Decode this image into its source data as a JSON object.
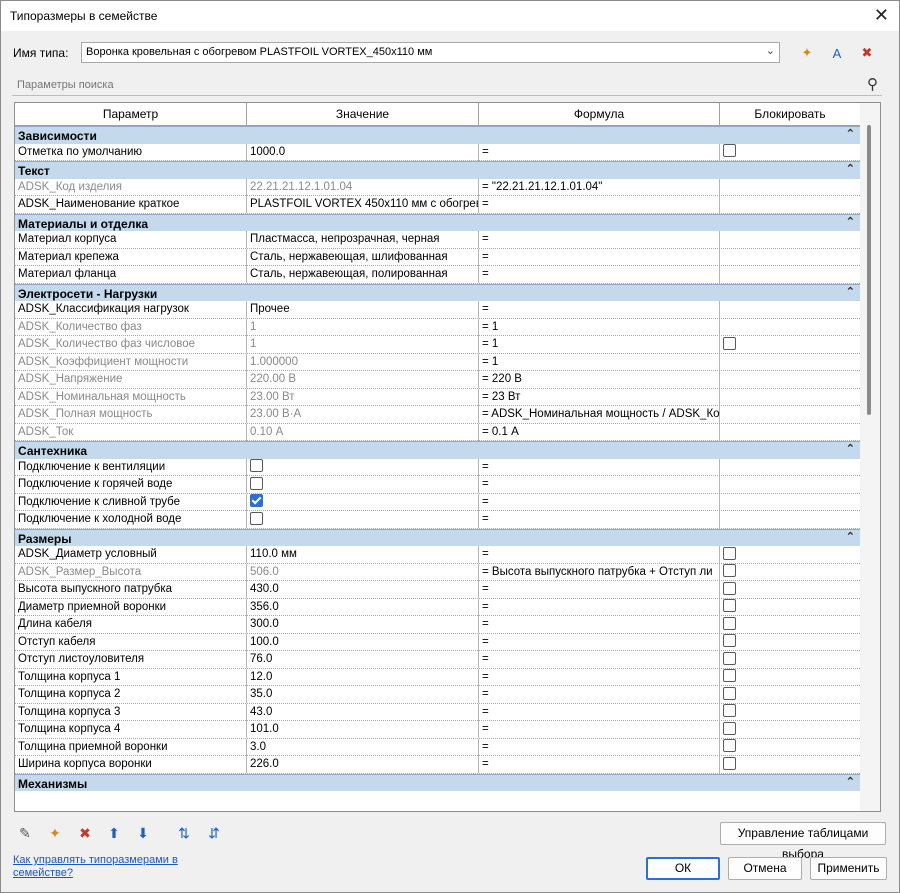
{
  "window": {
    "title": "Типоразмеры в семействе",
    "close_label": "✕"
  },
  "type_row": {
    "label": "Имя типа:",
    "value": "Воронка кровельная с обогревом PLASTFOIL VORTEX_450x110 мм"
  },
  "search": {
    "placeholder": "Параметры поиска"
  },
  "columns": [
    "Параметр",
    "Значение",
    "Формула",
    "Блокировать"
  ],
  "groups": [
    {
      "name": "Зависимости",
      "rows": [
        {
          "param": "Отметка по умолчанию",
          "value": "1000.0",
          "formula": "=",
          "lock": "unchecked",
          "readonly": false
        }
      ]
    },
    {
      "name": "Текст",
      "rows": [
        {
          "param": "ADSK_Код изделия",
          "value": "22.21.21.12.1.01.04",
          "formula": "= \"22.21.21.12.1.01.04\"",
          "lock": "none",
          "readonly": true
        },
        {
          "param": "ADSK_Наименование краткое",
          "value": "PLASTFOIL VORTEX 450x110 мм с обогрево",
          "formula": "=",
          "lock": "none",
          "readonly": false
        }
      ]
    },
    {
      "name": "Материалы и отделка",
      "rows": [
        {
          "param": "Материал корпуса",
          "value": "Пластмасса, непрозрачная, черная",
          "formula": "=",
          "lock": "none",
          "readonly": false
        },
        {
          "param": "Материал крепежа",
          "value": "Сталь, нержавеющая, шлифованная",
          "formula": "=",
          "lock": "none",
          "readonly": false
        },
        {
          "param": "Материал фланца",
          "value": "Сталь, нержавеющая, полированная",
          "formula": "=",
          "lock": "none",
          "readonly": false
        }
      ]
    },
    {
      "name": "Электросети - Нагрузки",
      "rows": [
        {
          "param": "ADSK_Классификация нагрузок",
          "value": "Прочее",
          "formula": "=",
          "lock": "none",
          "readonly": false
        },
        {
          "param": "ADSK_Количество фаз",
          "value": "1",
          "formula": "= 1",
          "lock": "none",
          "readonly": true
        },
        {
          "param": "ADSK_Количество фаз числовое",
          "value": "1",
          "formula": "= 1",
          "lock": "unchecked",
          "readonly": true
        },
        {
          "param": "ADSK_Коэффициент мощности",
          "value": "1.000000",
          "formula": "= 1",
          "lock": "none",
          "readonly": true
        },
        {
          "param": "ADSK_Напряжение",
          "value": "220.00 В",
          "formula": "= 220 В",
          "lock": "none",
          "readonly": true
        },
        {
          "param": "ADSK_Номинальная мощность",
          "value": "23.00 Вт",
          "formula": "= 23 Вт",
          "lock": "none",
          "readonly": true
        },
        {
          "param": "ADSK_Полная мощность",
          "value": "23.00 В·А",
          "formula": "= ADSK_Номинальная мощность / ADSK_Ко",
          "lock": "none",
          "readonly": true
        },
        {
          "param": "ADSK_Ток",
          "value": "0.10 А",
          "formula": "= 0.1 А",
          "lock": "none",
          "readonly": true
        }
      ]
    },
    {
      "name": "Сантехника",
      "rows": [
        {
          "param": "Подключение к вентиляции",
          "value": "",
          "value_checkbox": "unchecked",
          "formula": "=",
          "lock": "none",
          "readonly": false
        },
        {
          "param": "Подключение к горячей воде",
          "value": "",
          "value_checkbox": "unchecked",
          "formula": "=",
          "lock": "none",
          "readonly": false
        },
        {
          "param": "Подключение к сливной трубе",
          "value": "",
          "value_checkbox": "checked",
          "formula": "=",
          "lock": "none",
          "readonly": false
        },
        {
          "param": "Подключение к холодной воде",
          "value": "",
          "value_checkbox": "unchecked",
          "formula": "=",
          "lock": "none",
          "readonly": false
        }
      ]
    },
    {
      "name": "Размеры",
      "rows": [
        {
          "param": "ADSK_Диаметр условный",
          "value": "110.0 мм",
          "formula": "=",
          "lock": "unchecked",
          "readonly": false
        },
        {
          "param": "ADSK_Размер_Высота",
          "value": "506.0",
          "formula": "= Высота выпускного патрубка + Отступ ли",
          "lock": "unchecked",
          "readonly": true
        },
        {
          "param": "Высота выпускного патрубка",
          "value": "430.0",
          "formula": "=",
          "lock": "unchecked",
          "readonly": false
        },
        {
          "param": "Диаметр приемной воронки",
          "value": "356.0",
          "formula": "=",
          "lock": "unchecked",
          "readonly": false
        },
        {
          "param": "Длина кабеля",
          "value": "300.0",
          "formula": "=",
          "lock": "unchecked",
          "readonly": false
        },
        {
          "param": "Отступ кабеля",
          "value": "100.0",
          "formula": "=",
          "lock": "unchecked",
          "readonly": false
        },
        {
          "param": "Отступ листоуловителя",
          "value": "76.0",
          "formula": "=",
          "lock": "unchecked",
          "readonly": false
        },
        {
          "param": "Толщина корпуса 1",
          "value": "12.0",
          "formula": "=",
          "lock": "unchecked",
          "readonly": false
        },
        {
          "param": "Толщина корпуса 2",
          "value": "35.0",
          "formula": "=",
          "lock": "unchecked",
          "readonly": false
        },
        {
          "param": "Толщина корпуса 3",
          "value": "43.0",
          "formula": "=",
          "lock": "unchecked",
          "readonly": false
        },
        {
          "param": "Толщина корпуса 4",
          "value": "101.0",
          "formula": "=",
          "lock": "unchecked",
          "readonly": false
        },
        {
          "param": "Толщина приемной воронки",
          "value": "3.0",
          "formula": "=",
          "lock": "unchecked",
          "readonly": false
        },
        {
          "param": "Ширина корпуса воронки",
          "value": "226.0",
          "formula": "=",
          "lock": "unchecked",
          "readonly": false
        }
      ]
    },
    {
      "name": "Механизмы",
      "rows": []
    }
  ],
  "toolbar_icons": [
    {
      "name": "edit-parameter-icon",
      "glyph": "✎",
      "color": "#555555"
    },
    {
      "name": "new-parameter-icon",
      "glyph": "✦",
      "color": "#d08a20"
    },
    {
      "name": "delete-parameter-icon",
      "glyph": "✖",
      "color": "#c0392b"
    },
    {
      "name": "move-up-icon",
      "glyph": "⬆",
      "color": "#1f5fbf"
    },
    {
      "name": "move-down-icon",
      "glyph": "⬇",
      "color": "#1f5fbf"
    },
    {
      "name": "sort-ascending-icon",
      "glyph": "⇅",
      "color": "#1f5fbf"
    },
    {
      "name": "sort-descending-icon",
      "glyph": "⇵",
      "color": "#1f5fbf"
    }
  ],
  "type_icons": [
    {
      "name": "new-type-icon",
      "glyph": "✦",
      "color": "#d08a20"
    },
    {
      "name": "rename-type-icon",
      "glyph": "A",
      "color": "#1f5fbf"
    },
    {
      "name": "delete-type-icon",
      "glyph": "✖",
      "color": "#c0392b"
    }
  ],
  "buttons": {
    "lookup": "Управление таблицами выбора",
    "ok": "ОК",
    "cancel": "Отмена",
    "apply": "Применить"
  },
  "help_link": "Как управлять типоразмерами в семействе?",
  "collapse_glyph": "⌃"
}
